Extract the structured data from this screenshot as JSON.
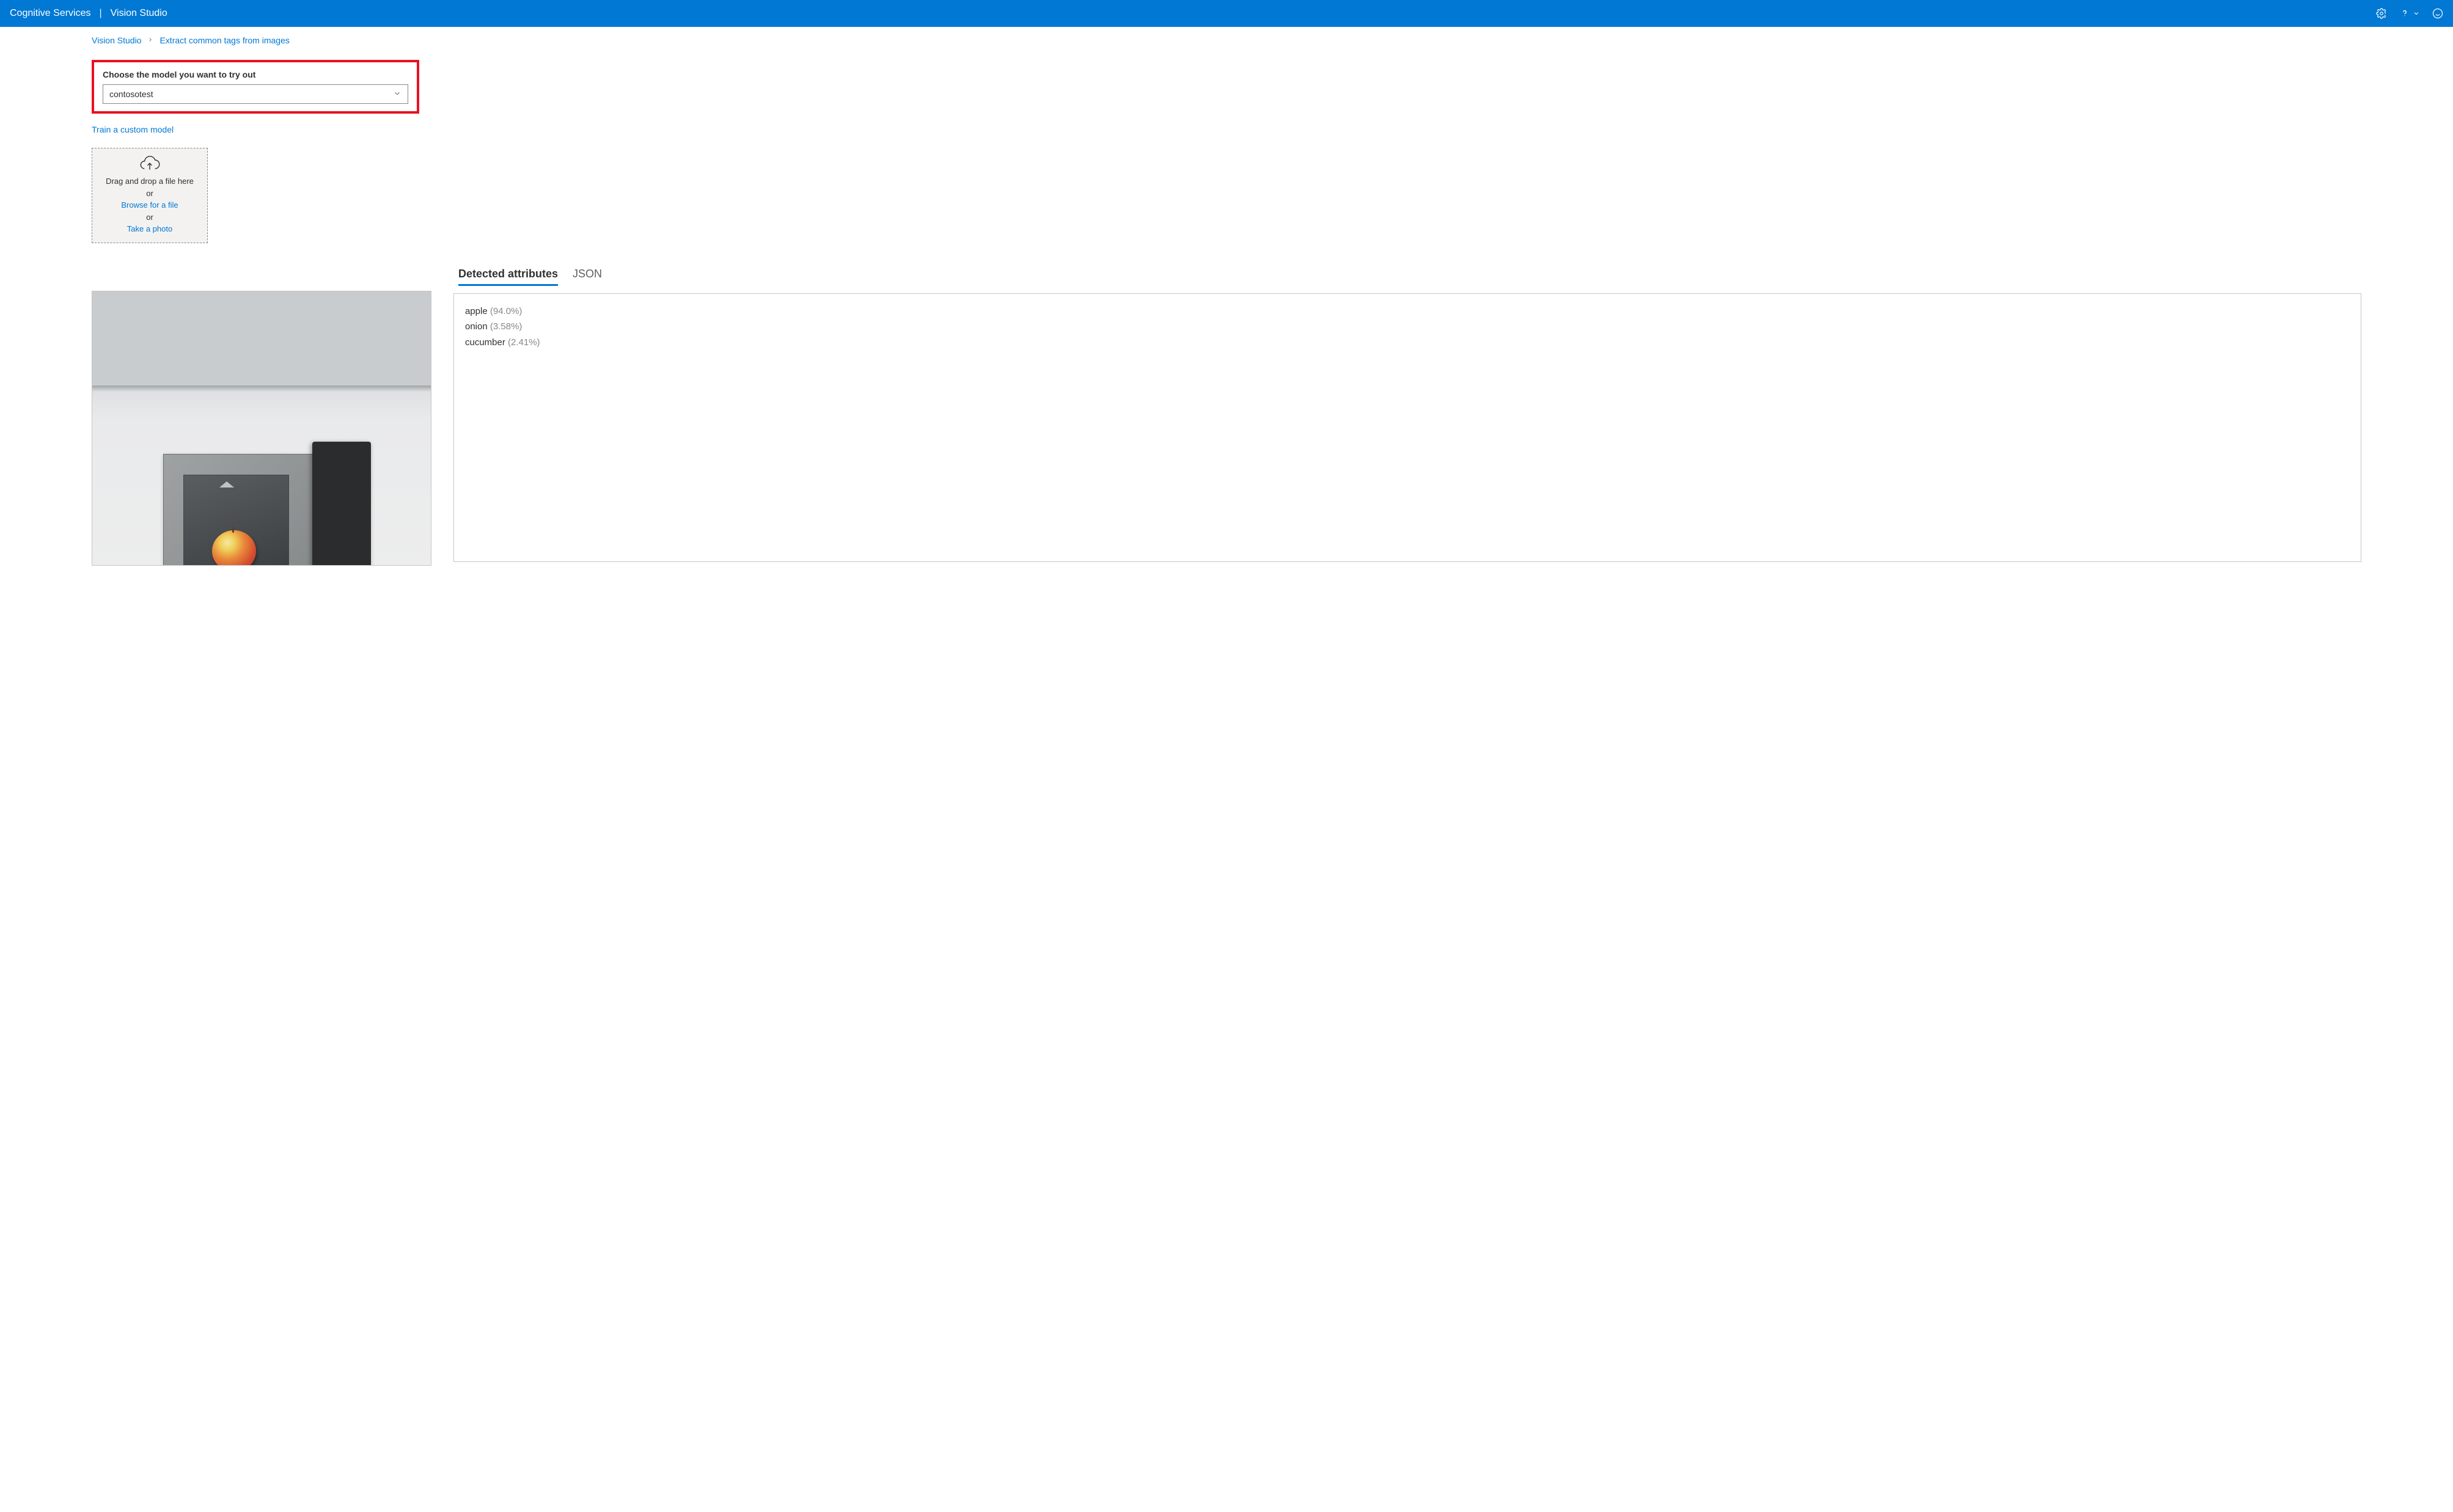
{
  "header": {
    "brand": "Cognitive Services",
    "app": "Vision Studio"
  },
  "breadcrumb": {
    "root": "Vision Studio",
    "current": "Extract common tags from images"
  },
  "model_select": {
    "label": "Choose the model you want to try out",
    "value": "contosotest",
    "train_link": "Train a custom model"
  },
  "dropzone": {
    "line1": "Drag and drop a file here",
    "or1": "or",
    "browse": "Browse for a file",
    "or2": "or",
    "photo": "Take a photo"
  },
  "tabs": {
    "attributes": "Detected attributes",
    "json": "JSON"
  },
  "results": [
    {
      "name": "apple",
      "conf": "(94.0%)"
    },
    {
      "name": "onion",
      "conf": "(3.58%)"
    },
    {
      "name": "cucumber",
      "conf": "(2.41%)"
    }
  ]
}
